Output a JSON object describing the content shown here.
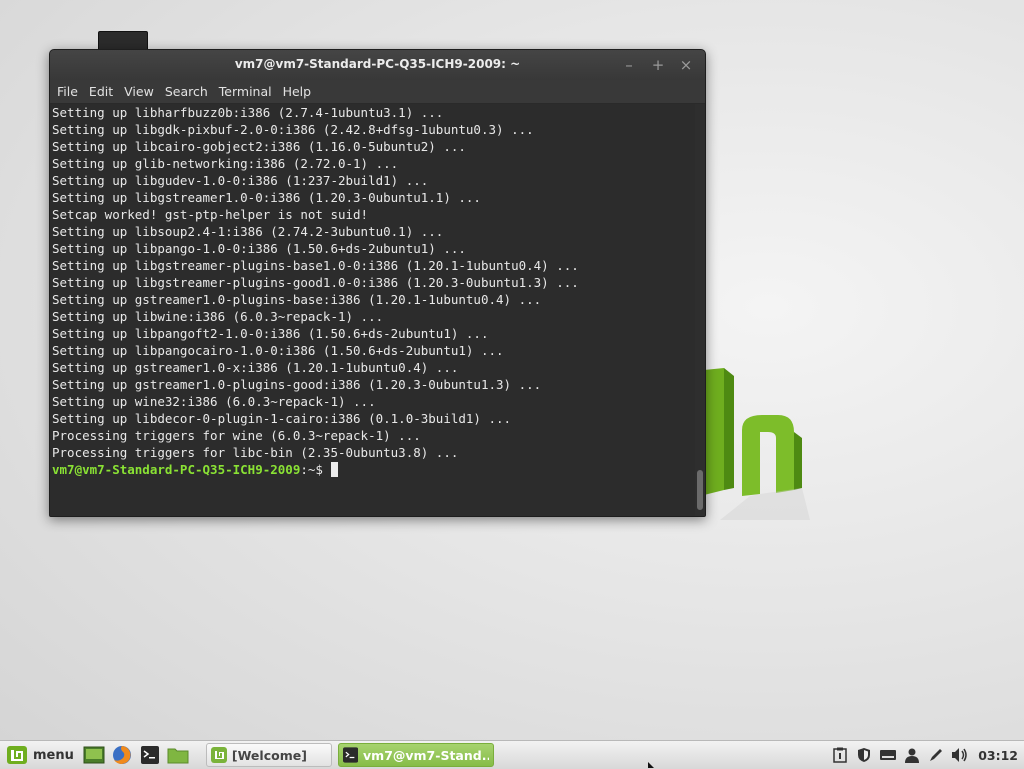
{
  "window": {
    "title": "vm7@vm7-Standard-PC-Q35-ICH9-2009: ~",
    "controls": {
      "minimize": "–",
      "maximize": "+",
      "close": "×"
    }
  },
  "menubar": [
    "File",
    "Edit",
    "View",
    "Search",
    "Terminal",
    "Help"
  ],
  "terminal": {
    "lines": [
      "Setting up libharfbuzz0b:i386 (2.7.4-1ubuntu3.1) ...",
      "Setting up libgdk-pixbuf-2.0-0:i386 (2.42.8+dfsg-1ubuntu0.3) ...",
      "Setting up libcairo-gobject2:i386 (1.16.0-5ubuntu2) ...",
      "Setting up glib-networking:i386 (2.72.0-1) ...",
      "Setting up libgudev-1.0-0:i386 (1:237-2build1) ...",
      "Setting up libgstreamer1.0-0:i386 (1.20.3-0ubuntu1.1) ...",
      "Setcap worked! gst-ptp-helper is not suid!",
      "Setting up libsoup2.4-1:i386 (2.74.2-3ubuntu0.1) ...",
      "Setting up libpango-1.0-0:i386 (1.50.6+ds-2ubuntu1) ...",
      "Setting up libgstreamer-plugins-base1.0-0:i386 (1.20.1-1ubuntu0.4) ...",
      "Setting up libgstreamer-plugins-good1.0-0:i386 (1.20.3-0ubuntu1.3) ...",
      "Setting up gstreamer1.0-plugins-base:i386 (1.20.1-1ubuntu0.4) ...",
      "Setting up libwine:i386 (6.0.3~repack-1) ...",
      "Setting up libpangoft2-1.0-0:i386 (1.50.6+ds-2ubuntu1) ...",
      "Setting up libpangocairo-1.0-0:i386 (1.50.6+ds-2ubuntu1) ...",
      "Setting up gstreamer1.0-x:i386 (1.20.1-1ubuntu0.4) ...",
      "Setting up gstreamer1.0-plugins-good:i386 (1.20.3-0ubuntu1.3) ...",
      "Setting up wine32:i386 (6.0.3~repack-1) ...",
      "Setting up libdecor-0-plugin-1-cairo:i386 (0.1.0-3build1) ...",
      "Processing triggers for wine (6.0.3~repack-1) ...",
      "Processing triggers for libc-bin (2.35-0ubuntu3.8) ..."
    ],
    "prompt_user": "vm7@vm7-Standard-PC-Q35-ICH9-2009",
    "prompt_suffix": ":~$ "
  },
  "taskbar": {
    "menu_label": "menu",
    "launchers": [
      "show-desktop-icon",
      "firefox-icon",
      "terminal-icon",
      "files-icon"
    ],
    "tasks": [
      {
        "label": "[Welcome]",
        "icon": "mint-welcome-icon"
      },
      {
        "label": "vm7@vm7-Stand...",
        "icon": "terminal-icon"
      }
    ],
    "tray": [
      "clipboard-icon",
      "shield-icon",
      "keyboard-icon",
      "user-icon",
      "pen-icon",
      "volume-icon"
    ],
    "clock": "03:12"
  },
  "colors": {
    "prompt": "#8ae234",
    "accent": "#87bd48",
    "terminal_bg": "#2c2c2c"
  }
}
